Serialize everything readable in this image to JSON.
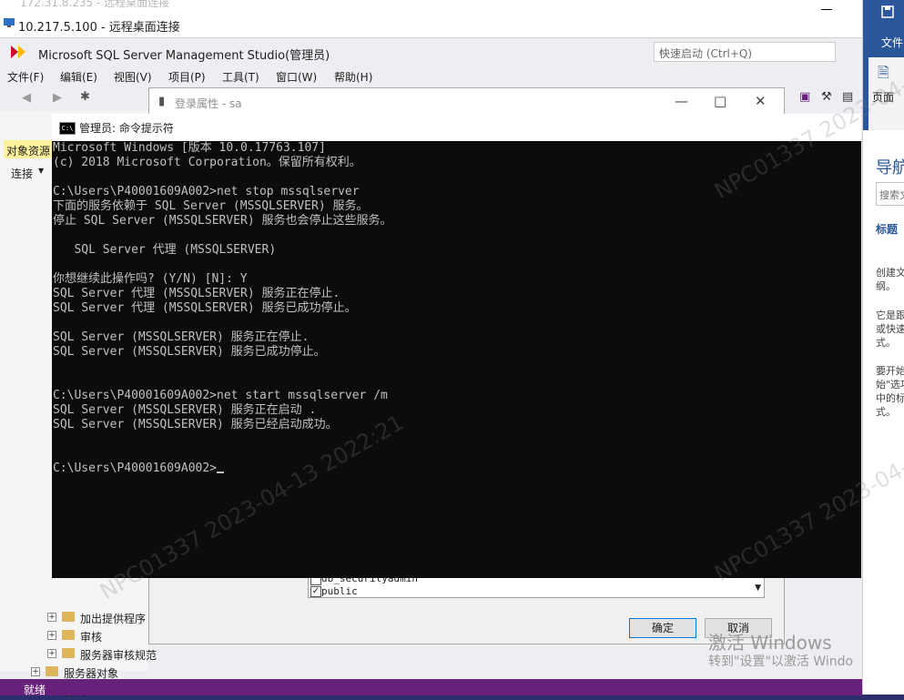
{
  "rdp": {
    "faint_title": "172.31.8.235 - 远程桌面连接",
    "title": "10.217.5.100 - 远程桌面连接"
  },
  "ssms": {
    "title": "Microsoft SQL Server Management Studio(管理员)",
    "quick_launch_placeholder": "快速启动 (Ctrl+Q)",
    "menu": [
      "文件(F)",
      "编辑(E)",
      "视图(V)",
      "项目(P)",
      "工具(T)",
      "窗口(W)",
      "帮助(H)"
    ],
    "object_explorer_tab": "对象资源",
    "connect_label": "连接",
    "tree_items": [
      {
        "label": "加出提供程序"
      },
      {
        "label": "审核"
      },
      {
        "label": "服务器审核规范"
      },
      {
        "label": "服务器对象"
      },
      {
        "label": "复制"
      }
    ],
    "status": "就绪"
  },
  "login_dialog": {
    "title": "登录属性 - sa",
    "list_items": [
      "db_securityadmin",
      "public"
    ],
    "ok_label": "确定",
    "cancel_label": "取消"
  },
  "cmd": {
    "title": "管理员: 命令提示符",
    "lines": [
      "Microsoft Windows [版本 10.0.17763.107]",
      "(c) 2018 Microsoft Corporation。保留所有权利。",
      "",
      "C:\\Users\\P40001609A002>net stop mssqlserver",
      "下面的服务依赖于 SQL Server (MSSQLSERVER) 服务。",
      "停止 SQL Server (MSSQLSERVER) 服务也会停止这些服务。",
      "",
      "   SQL Server 代理 (MSSQLSERVER)",
      "",
      "你想继续此操作吗? (Y/N) [N]: Y",
      "SQL Server 代理 (MSSQLSERVER) 服务正在停止.",
      "SQL Server 代理 (MSSQLSERVER) 服务已成功停止。",
      "",
      "SQL Server (MSSQLSERVER) 服务正在停止.",
      "SQL Server (MSSQLSERVER) 服务已成功停止。",
      "",
      "",
      "C:\\Users\\P40001609A002>net start mssqlserver /m",
      "SQL Server (MSSQLSERVER) 服务正在启动 .",
      "SQL Server (MSSQLSERVER) 服务已经启动成功。",
      "",
      "",
      "C:\\Users\\P40001609A002>"
    ]
  },
  "word": {
    "file_label": "文件",
    "page_label": "页面",
    "nav_title": "导航",
    "search_placeholder": "搜索文",
    "tab_label": "标题",
    "text1": [
      "创建文",
      "纲。"
    ],
    "text2": [
      "它是跟",
      "或快速",
      "式。"
    ],
    "text3": [
      "要开始",
      "始\"选项",
      "中的标",
      "式。"
    ]
  },
  "watermark": {
    "text1": "NPC01337  2023-04-13  2022:21",
    "text2": "NPC01337  2023-04-13  2022:21",
    "text3": "NPC01337  2023-04-"
  },
  "activation": {
    "line1": "激活 Windows",
    "line2": "转到\"设置\"以激活 Windo"
  }
}
